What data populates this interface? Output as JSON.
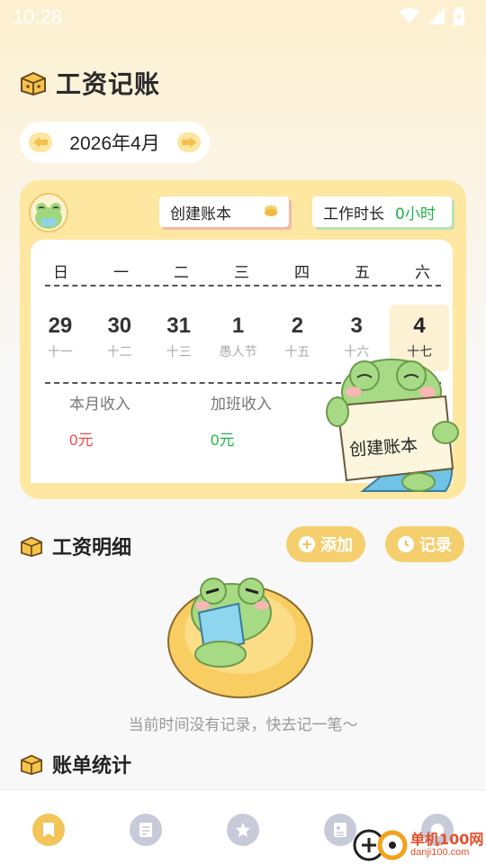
{
  "status_bar": {
    "time": "10:28"
  },
  "header": {
    "title": "工资记账"
  },
  "month_selector": {
    "label": "2026年4月"
  },
  "calendar_card": {
    "create_button_label": "创建账本",
    "work_hours_label": "工作时长",
    "work_hours_value": "0小时",
    "weekdays": [
      "日",
      "一",
      "二",
      "三",
      "四",
      "五",
      "六"
    ],
    "dates": [
      {
        "num": "29",
        "sub": "十一"
      },
      {
        "num": "30",
        "sub": "十二"
      },
      {
        "num": "31",
        "sub": "十三"
      },
      {
        "num": "1",
        "sub": "愚人节"
      },
      {
        "num": "2",
        "sub": "十五"
      },
      {
        "num": "3",
        "sub": "十六"
      },
      {
        "num": "4",
        "sub": "十七"
      }
    ],
    "monthly_income_label": "本月收入",
    "monthly_income_value": "0元",
    "overtime_income_label": "加班收入",
    "overtime_income_value": "0元",
    "note_text": "创建账本"
  },
  "salary_detail": {
    "title": "工资明细",
    "add_label": "添加",
    "record_label": "记录",
    "empty_text": "当前时间没有记录，快去记一笔～"
  },
  "bill_stats": {
    "title": "账单统计"
  },
  "watermark": {
    "name": "单机100网",
    "url": "danji100.com"
  },
  "colors": {
    "accent": "#f5cf6e",
    "income_red": "#f04848",
    "overtime_green": "#1fb34a",
    "nav_active": "#f3c457",
    "nav_inactive": "#c7cbd9"
  }
}
